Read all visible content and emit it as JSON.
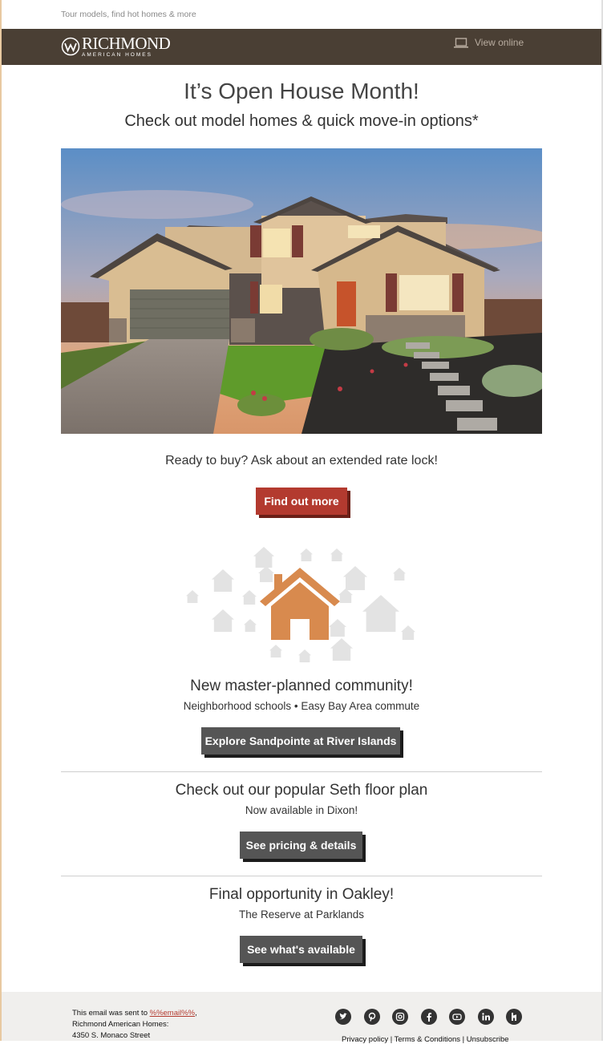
{
  "preheader": "Tour models, find hot homes & more",
  "header": {
    "logo_main": "RICHMOND",
    "logo_sub": "AMERICAN HOMES",
    "view_online": "View online"
  },
  "hero": {
    "title": "It’s Open House Month!",
    "subtitle": "Check out model homes & quick move-in options*",
    "image_icon": "house-photo"
  },
  "rate_lock": {
    "text": "Ready to buy? Ask about an extended rate lock!",
    "button": "Find out more"
  },
  "sections": [
    {
      "title": "New master-planned community!",
      "subtitle": "Neighborhood schools • Easy Bay Area commute",
      "button": "Explore Sandpointe at River Islands"
    },
    {
      "title": "Check out our popular Seth floor plan",
      "subtitle": "Now available in Dixon!",
      "button": "See pricing & details"
    },
    {
      "title": "Final opportunity in Oakley!",
      "subtitle": "The Reserve at Parklands",
      "button": "See what's available"
    }
  ],
  "footer": {
    "sent_to_prefix": "This email was sent to ",
    "email": "%%email%%",
    "sent_to_suffix": ",",
    "company": "Richmond American Homes:",
    "address": "4350 S. Monaco Street",
    "links": "Privacy policy | Terms & Conditions | Unsubscribe",
    "social_icons": [
      "twitter-icon",
      "pinterest-icon",
      "instagram-icon",
      "facebook-icon",
      "youtube-icon",
      "linkedin-icon",
      "houzz-icon"
    ]
  },
  "colors": {
    "header_bg": "#4a3f34",
    "red_button": "#b33a2f",
    "dark_button": "#555555",
    "house_orange": "#d88a4e"
  }
}
